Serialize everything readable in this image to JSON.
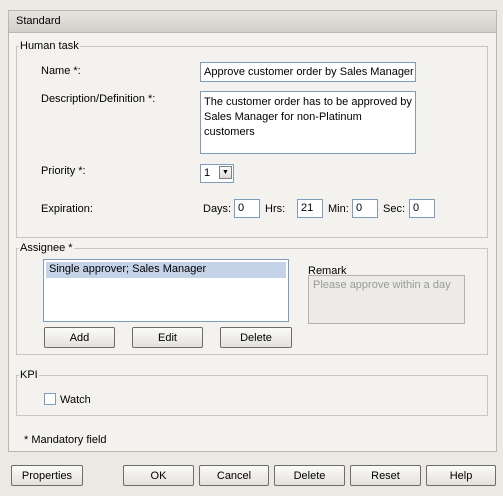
{
  "panel": {
    "title": "Standard"
  },
  "human_task": {
    "legend": "Human task",
    "name_label": "Name *:",
    "name_value": "Approve customer order by Sales Manager",
    "description_label": "Description/Definition *:",
    "description_value": "The customer order has to be approved by Sales Manager for non-Platinum customers",
    "priority_label": "Priority *:",
    "priority_value": "1",
    "expiration_label": "Expiration:",
    "days_label": "Days:",
    "days_value": "0",
    "hrs_label": "Hrs:",
    "hrs_value": "21",
    "min_label": "Min:",
    "min_value": "0",
    "sec_label": "Sec:",
    "sec_value": "0"
  },
  "assignee": {
    "legend": "Assignee *",
    "items": [
      "Single approver; Sales Manager"
    ],
    "remark_label": "Remark",
    "remark_placeholder": "Please approve within a day",
    "add_label": "Add",
    "edit_label": "Edit",
    "delete_label": "Delete"
  },
  "kpi": {
    "legend": "KPI",
    "watch_label": "Watch"
  },
  "footnote": "* Mandatory field",
  "buttons": {
    "properties": "Properties",
    "ok": "OK",
    "cancel": "Cancel",
    "delete": "Delete",
    "reset": "Reset",
    "help": "Help"
  }
}
